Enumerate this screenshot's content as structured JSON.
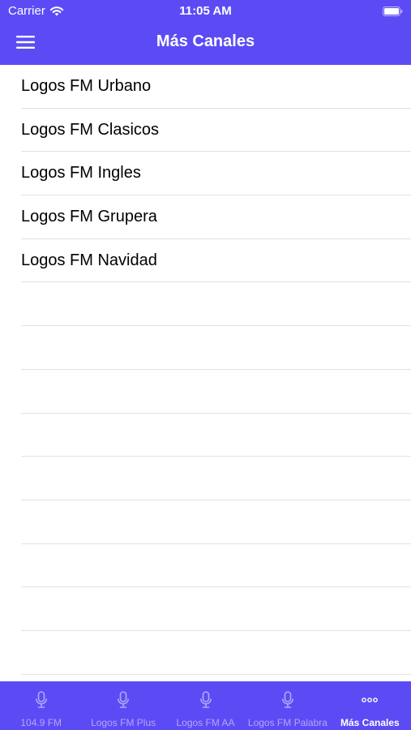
{
  "status_bar": {
    "carrier": "Carrier",
    "time": "11:05 AM",
    "wifi_icon": "wifi-icon",
    "battery_icon": "battery-icon"
  },
  "nav": {
    "title": "Más Canales",
    "menu_icon": "hamburger-menu-icon"
  },
  "channels": [
    {
      "label": "Logos FM Urbano"
    },
    {
      "label": "Logos FM Clasicos"
    },
    {
      "label": "Logos FM Ingles"
    },
    {
      "label": "Logos FM Grupera"
    },
    {
      "label": "Logos FM Navidad"
    }
  ],
  "tabs": [
    {
      "label": "104.9 FM",
      "icon": "microphone-icon",
      "active": false
    },
    {
      "label": "Logos FM Plus",
      "icon": "microphone-icon",
      "active": false
    },
    {
      "label": "Logos FM AA",
      "icon": "microphone-icon",
      "active": false
    },
    {
      "label": "Logos FM Palabra",
      "icon": "microphone-icon",
      "active": false
    },
    {
      "label": "Más Canales",
      "icon": "more-icon",
      "active": true
    }
  ],
  "colors": {
    "brand": "#5c4bf5",
    "tab_inactive": "#b1a8f9",
    "tab_active": "#ffffff",
    "separator": "#e2e2e6"
  }
}
